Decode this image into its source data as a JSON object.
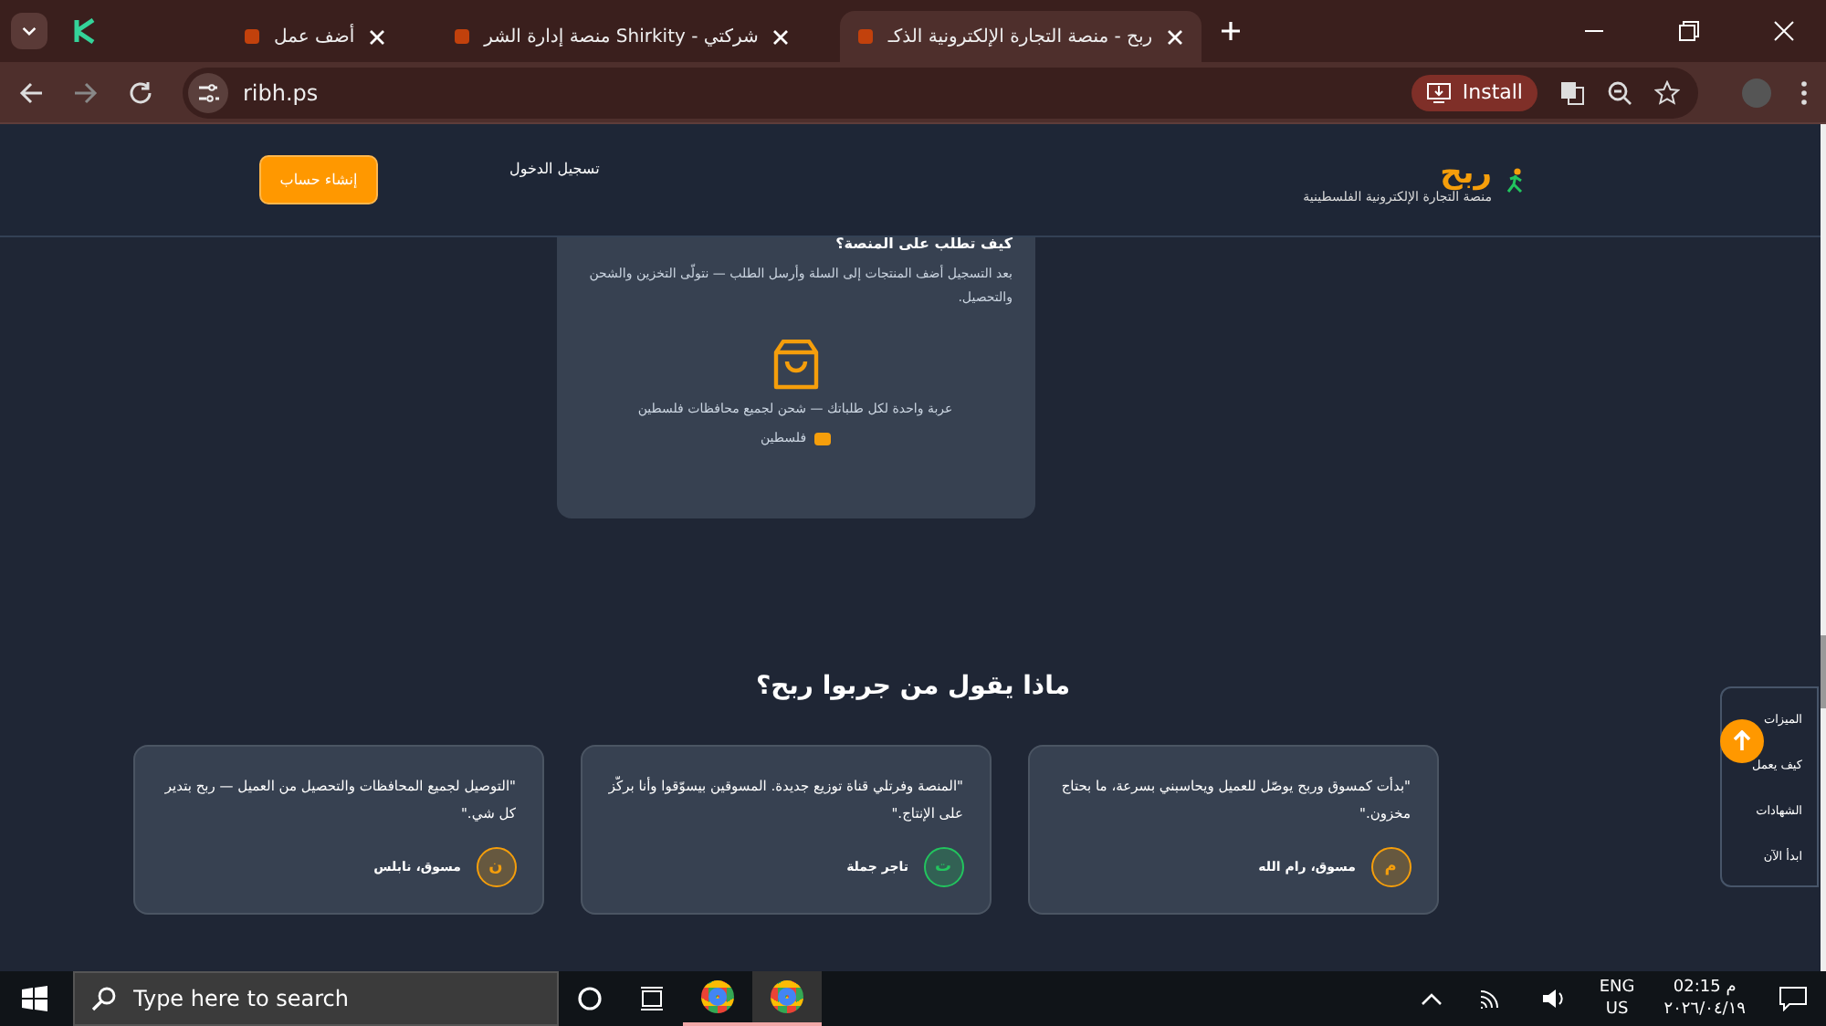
{
  "browser": {
    "tabs": [
      {
        "title": "ربح - منصة التجارة الإلكترونية الذكـ",
        "selected": true
      },
      {
        "title": "شركتي - Shirkity منصة إدارة الشر",
        "selected": false
      },
      {
        "title": "أضف عمل",
        "selected": false
      }
    ],
    "url": "ribh.ps",
    "install_label": "Install"
  },
  "header": {
    "logo_title": "ربح",
    "logo_subtitle": "منصة التجارة الإلكترونية الفلسطينية",
    "login": "تسجيل الدخول",
    "signup": "إنشاء حساب"
  },
  "how_card": {
    "title": "كيف تطلب على المنصة؟",
    "text": "بعد التسجيل أضف المنتجات إلى السلة وأرسل الطلب — نتولّى التخزين والشحن والتحصيل.",
    "caption": "عربة واحدة لكل طلباتك — شحن لجميع محافظات فلسطين",
    "badge": "فلسطين"
  },
  "testimonials": {
    "title": "ماذا يقول من جربوا ربح؟",
    "items": [
      {
        "quote": "\"بدأت كمسوق وربح يوصّل للعميل ويحاسبني بسرعة، ما بحتاج مخزون.\"",
        "initial": "م",
        "name": "مسوق، رام الله",
        "color": "#f59e0b"
      },
      {
        "quote": "\"المنصة وفرتلي قناة توزيع جديدة. المسوقين بيسوّقوا وأنا بركّز على الإنتاج.\"",
        "initial": "ت",
        "name": "تاجر جملة",
        "color": "#22c55e"
      },
      {
        "quote": "\"التوصيل لجميع المحافظات والتحصيل من العميل — ربح بتدير كل شي.\"",
        "initial": "ن",
        "name": "مسوق، نابلس",
        "color": "#f59e0b"
      }
    ]
  },
  "side_nav": [
    "الميزات",
    "كيف يعمل",
    "الشهادات",
    "ابدأ الآن"
  ],
  "taskbar": {
    "search_placeholder": "Type here to search",
    "lang": "ENG",
    "region": "US",
    "time": "02:15 م",
    "date": "٢٠٢٦/٠٤/١٩"
  }
}
